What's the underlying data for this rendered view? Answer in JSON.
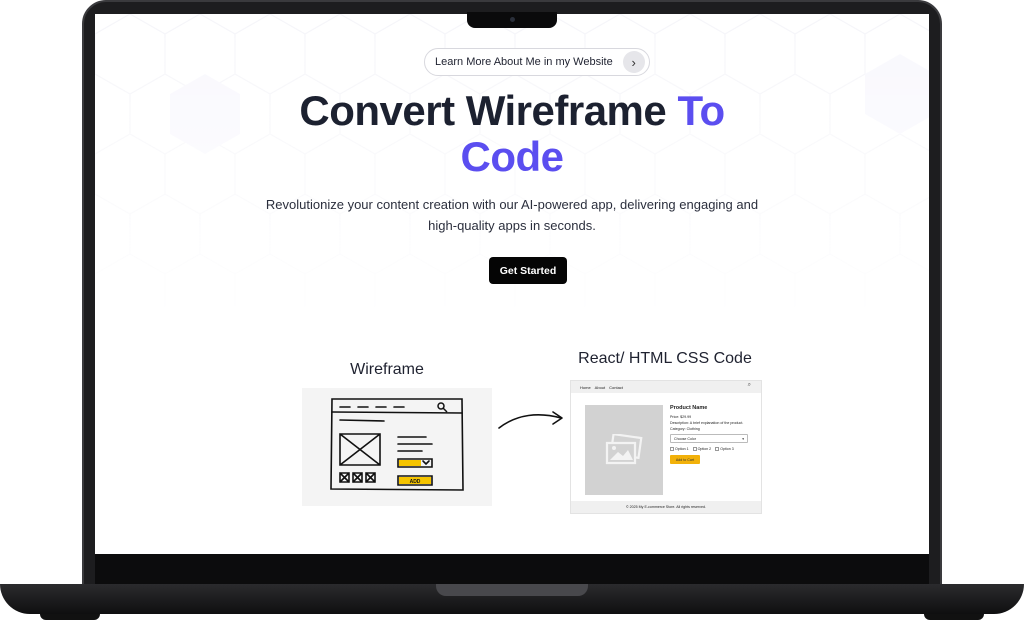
{
  "hero": {
    "pill_label": "Learn More About Me in my Website",
    "title_line1_dark": "Convert Wireframe ",
    "title_line1_accent": "To",
    "title_line2_accent": "Code",
    "subtitle": "Revolutionize your content creation with our AI-powered app, delivering engaging and high-quality apps in seconds.",
    "cta_label": "Get Started",
    "accent_color": "#5b4ef0"
  },
  "showcase": {
    "wireframe_label": "Wireframe",
    "wireframe_add_label": "ADD",
    "code_label": "React/ HTML CSS Code",
    "preview": {
      "nav": [
        "Home",
        "About",
        "Contact"
      ],
      "product_name": "Product Name",
      "price": "Price: $29.99",
      "description": "Description: A brief explanation of the product.",
      "category": "Category: Clothing",
      "select_placeholder": "Choose Color",
      "options": [
        "Option 1",
        "Option 2",
        "Option 3"
      ],
      "add_label": "Add to Cart",
      "footer": "© 2025 My E-commerce Store. All rights reserved.",
      "add_button_color": "#f2b10a"
    }
  },
  "icons": {
    "pill_arrow": "chevron-right-icon",
    "wireframe_search": "search-icon",
    "arrow": "curved-arrow-icon",
    "image_placeholder": "image-placeholder-icon"
  }
}
